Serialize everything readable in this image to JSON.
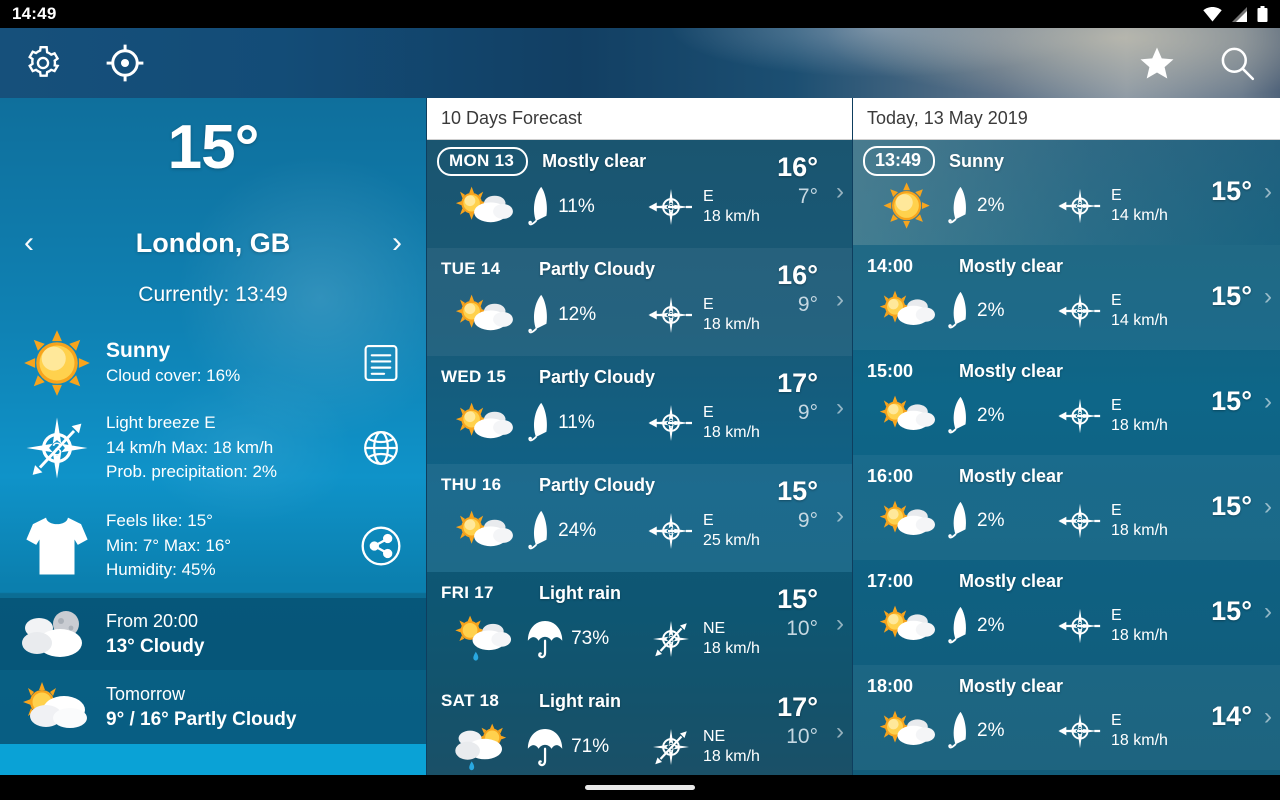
{
  "statusbar": {
    "time": "14:49",
    "icons": [
      "wifi-icon",
      "signal-icon",
      "battery-icon"
    ]
  },
  "appbar": {
    "settings_label": "Settings",
    "location_label": "My location",
    "favorites_label": "Favorites",
    "search_label": "Search"
  },
  "current": {
    "temperature": "15°",
    "city": "London, GB",
    "prev_label": "‹",
    "next_label": "›",
    "time_line": "Currently: 13:49",
    "condition": "Sunny",
    "cloud_cover": "Cloud cover: 16%",
    "wind_title": "Light breeze E",
    "wind_speed": "14 km/h Max: 18 km/h",
    "precipitation": "Prob. precipitation: 2%",
    "wind_force": "3",
    "feels_like": "Feels like: 15°",
    "min_max": "Min: 7° Max: 16°",
    "humidity": "Humidity: 45%",
    "evening_time": "From 20:00",
    "evening_summary": "13° Cloudy",
    "tomorrow_label": "Tomorrow",
    "tomorrow_summary": "9° / 16° Partly Cloudy"
  },
  "daily": {
    "title": "10 Days Forecast",
    "rows": [
      {
        "day": "MON 13",
        "selected": true,
        "condition": "Mostly clear",
        "icon": "sun-cloud-icon",
        "precip": "11%",
        "precip_icon": "umbrella-closed-icon",
        "wind_force": "3",
        "wind_dir": "E",
        "wind_arrow": "W",
        "wind_speed": "18 km/h",
        "high": "16°",
        "low": "7°"
      },
      {
        "day": "TUE 14",
        "selected": false,
        "condition": "Partly Cloudy",
        "icon": "sun-cloud-icon",
        "precip": "12%",
        "precip_icon": "umbrella-closed-icon",
        "wind_force": "3",
        "wind_dir": "E",
        "wind_arrow": "W",
        "wind_speed": "18 km/h",
        "high": "16°",
        "low": "9°"
      },
      {
        "day": "WED 15",
        "selected": false,
        "condition": "Partly Cloudy",
        "icon": "sun-cloud-icon",
        "precip": "11%",
        "precip_icon": "umbrella-closed-icon",
        "wind_force": "3",
        "wind_dir": "E",
        "wind_arrow": "W",
        "wind_speed": "18 km/h",
        "high": "17°",
        "low": "9°"
      },
      {
        "day": "THU 16",
        "selected": false,
        "condition": "Partly Cloudy",
        "icon": "sun-cloud-icon",
        "precip": "24%",
        "precip_icon": "umbrella-closed-icon",
        "wind_force": "4",
        "wind_dir": "E",
        "wind_arrow": "W",
        "wind_speed": "25 km/h",
        "high": "15°",
        "low": "9°"
      },
      {
        "day": "FRI 17",
        "selected": false,
        "condition": "Light rain",
        "icon": "sun-cloud-rain-icon",
        "precip": "73%",
        "precip_icon": "umbrella-open-icon",
        "wind_force": "3",
        "wind_dir": "NE",
        "wind_arrow": "SW",
        "wind_speed": "18 km/h",
        "high": "15°",
        "low": "10°"
      },
      {
        "day": "SAT 18",
        "selected": false,
        "condition": "Light rain",
        "icon": "cloud-sun-rain-icon",
        "precip": "71%",
        "precip_icon": "umbrella-open-icon",
        "wind_force": "3",
        "wind_dir": "NE",
        "wind_arrow": "SW",
        "wind_speed": "18 km/h",
        "high": "17°",
        "low": "10°"
      }
    ]
  },
  "hourly": {
    "title": "Today, 13 May 2019",
    "rows": [
      {
        "time": "13:49",
        "now": true,
        "condition": "Sunny",
        "icon": "sun-icon",
        "precip": "2%",
        "precip_icon": "umbrella-closed-icon",
        "wind_force": "3",
        "wind_dir": "E",
        "wind_speed": "14 km/h",
        "temp": "15°"
      },
      {
        "time": "14:00",
        "now": false,
        "condition": "Mostly clear",
        "icon": "sun-cloud-icon",
        "precip": "2%",
        "precip_icon": "umbrella-closed-icon",
        "wind_force": "3",
        "wind_dir": "E",
        "wind_speed": "14 km/h",
        "temp": "15°"
      },
      {
        "time": "15:00",
        "now": false,
        "condition": "Mostly clear",
        "icon": "sun-cloud-icon",
        "precip": "2%",
        "precip_icon": "umbrella-closed-icon",
        "wind_force": "3",
        "wind_dir": "E",
        "wind_speed": "18 km/h",
        "temp": "15°"
      },
      {
        "time": "16:00",
        "now": false,
        "condition": "Mostly clear",
        "icon": "sun-cloud-icon",
        "precip": "2%",
        "precip_icon": "umbrella-closed-icon",
        "wind_force": "3",
        "wind_dir": "E",
        "wind_speed": "18 km/h",
        "temp": "15°"
      },
      {
        "time": "17:00",
        "now": false,
        "condition": "Mostly clear",
        "icon": "sun-cloud-icon",
        "precip": "2%",
        "precip_icon": "umbrella-closed-icon",
        "wind_force": "3",
        "wind_dir": "E",
        "wind_speed": "18 km/h",
        "temp": "15°"
      },
      {
        "time": "18:00",
        "now": false,
        "condition": "Mostly clear",
        "icon": "sun-cloud-icon",
        "precip": "2%",
        "precip_icon": "umbrella-closed-icon",
        "wind_force": "3",
        "wind_dir": "E",
        "wind_speed": "18 km/h",
        "temp": "14°"
      }
    ]
  },
  "colors": {
    "status_bg": "#000000",
    "panel_header_bg": "#ffffff",
    "left_panel_accent": "#0aa2d6",
    "sun_yellow": "#f5a623",
    "rain_blue": "#29a8e0"
  }
}
